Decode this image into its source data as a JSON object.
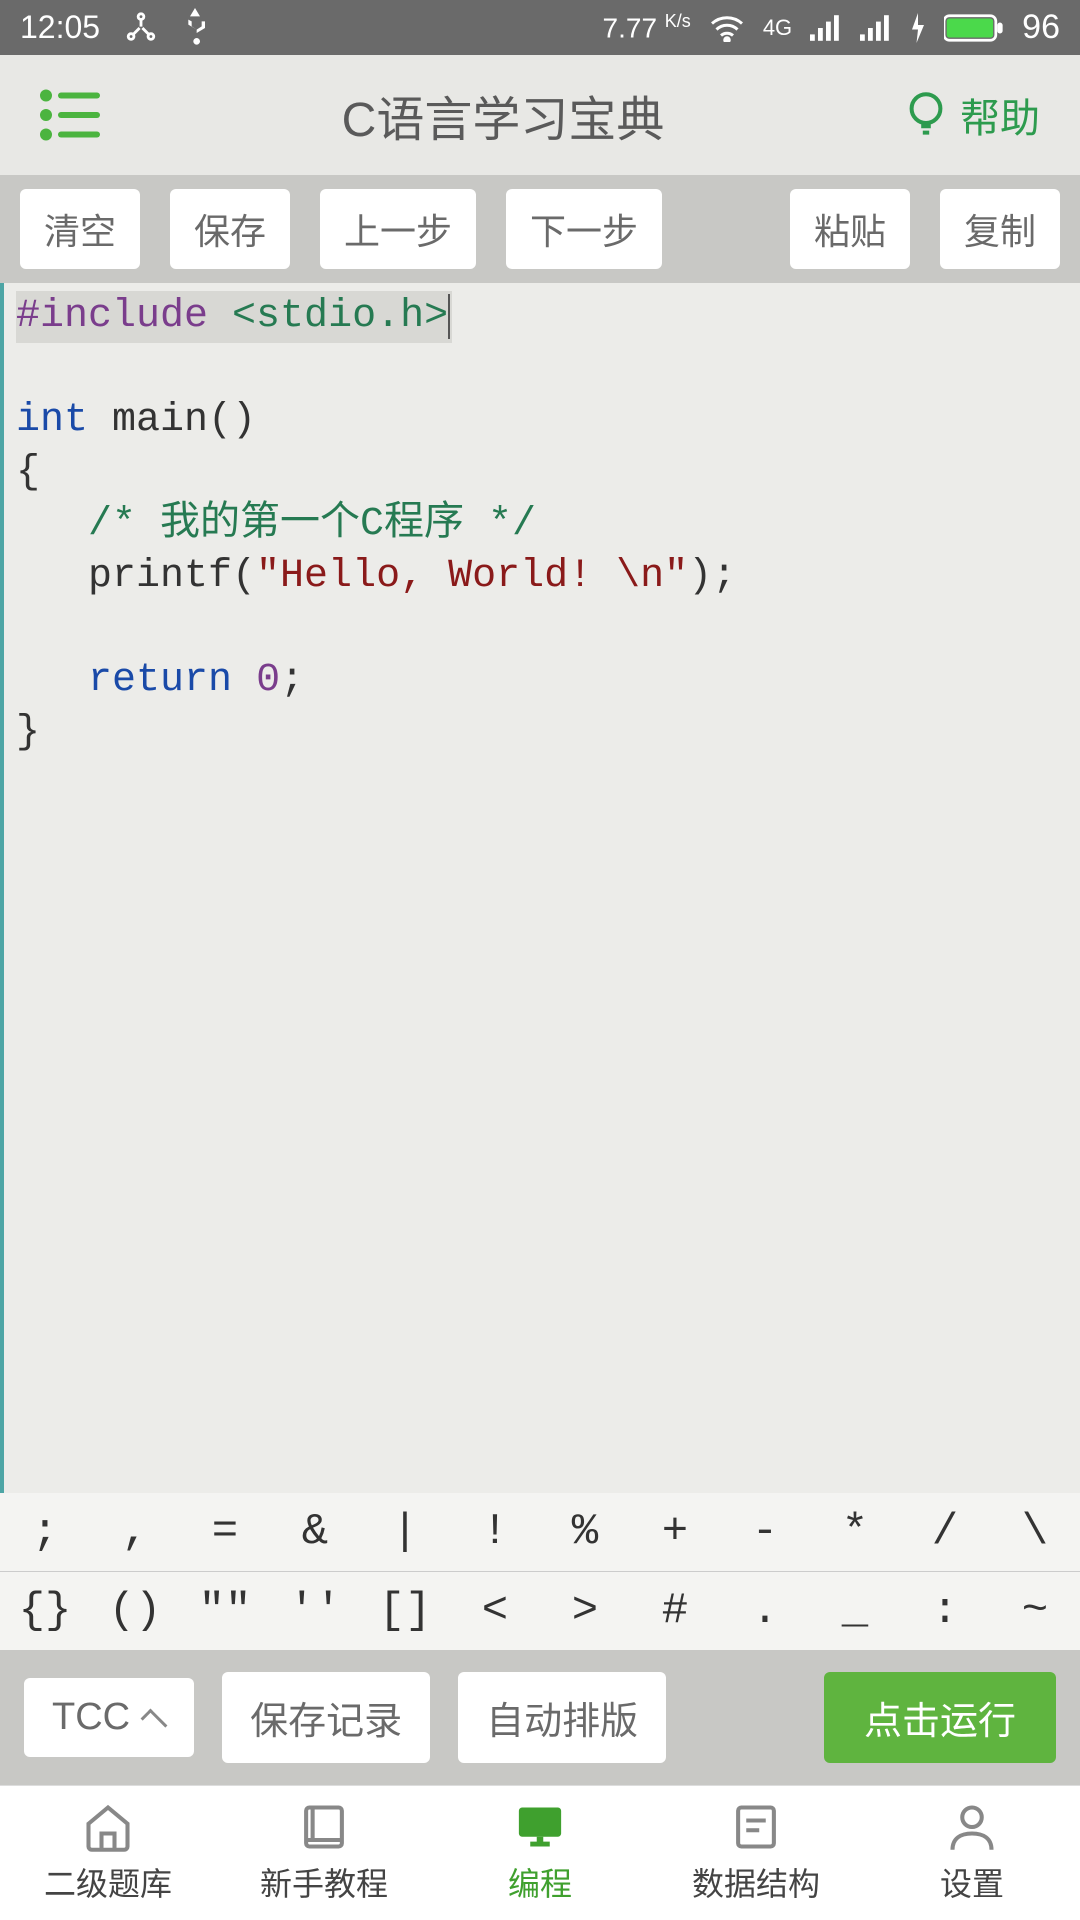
{
  "status": {
    "time": "12:05",
    "speed": "7.77",
    "speed_unit": "K/s",
    "network": "4G",
    "battery": "96"
  },
  "header": {
    "title": "C语言学习宝典",
    "help_label": "帮助"
  },
  "toolbar": {
    "clear": "清空",
    "save": "保存",
    "undo": "上一步",
    "redo": "下一步",
    "paste": "粘贴",
    "copy": "复制"
  },
  "code": {
    "include_kw": "#include",
    "include_hdr": "<stdio.h>",
    "type_int": "int",
    "main_sig": " main()",
    "brace_open": "{",
    "comment": "/* 我的第一个C程序 */",
    "printf_call": "   printf(",
    "hello_str": "\"Hello, World! \\n\"",
    "printf_end": ");",
    "return_kw": "return",
    "zero": "0",
    "semi": ";",
    "brace_close": "}"
  },
  "symbols": {
    "row1": [
      ";",
      ",",
      "=",
      "&",
      "|",
      "!",
      "%",
      "+",
      "-",
      "*",
      "/",
      "\\"
    ],
    "row2": [
      "{}",
      "()",
      "\"\"",
      "''",
      "[]",
      "<",
      ">",
      "#",
      ".",
      "_",
      ":",
      "~"
    ]
  },
  "actions": {
    "compiler": "TCC",
    "save_record": "保存记录",
    "auto_format": "自动排版",
    "run": "点击运行"
  },
  "nav": {
    "exam": "二级题库",
    "tutorial": "新手教程",
    "code": "编程",
    "ds": "数据结构",
    "settings": "设置"
  }
}
